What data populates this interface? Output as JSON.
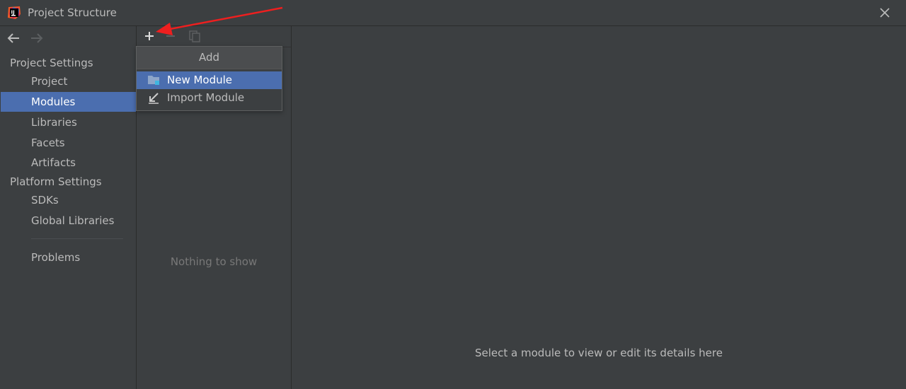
{
  "window": {
    "title": "Project Structure"
  },
  "sidebar": {
    "project_settings_header": "Project Settings",
    "platform_settings_header": "Platform Settings",
    "items": [
      {
        "label": "Project"
      },
      {
        "label": "Modules"
      },
      {
        "label": "Libraries"
      },
      {
        "label": "Facets"
      },
      {
        "label": "Artifacts"
      },
      {
        "label": "SDKs"
      },
      {
        "label": "Global Libraries"
      },
      {
        "label": "Problems"
      }
    ],
    "selected": "Modules"
  },
  "middle": {
    "empty_text": "Nothing to show"
  },
  "popup": {
    "header": "Add",
    "items": [
      {
        "label": "New Module",
        "icon": "folder-module-icon",
        "selected": true
      },
      {
        "label": "Import Module",
        "icon": "import-icon",
        "selected": false
      }
    ]
  },
  "right": {
    "hint": "Select a module to view or edit its details here"
  },
  "colors": {
    "background": "#3c3f41",
    "selection": "#4b6eaf",
    "text": "#bbbbbb",
    "muted_text": "#787878",
    "annotation": "#ee1f1f"
  }
}
